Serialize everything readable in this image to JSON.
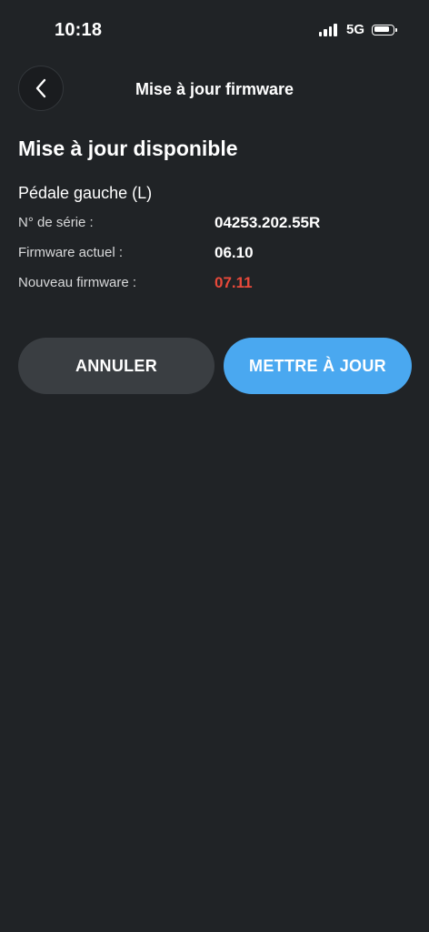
{
  "status_bar": {
    "time": "10:18",
    "network": "5G",
    "icons": [
      "cellular-signal-icon",
      "battery-icon"
    ]
  },
  "header": {
    "back_icon": "chevron-left-icon",
    "title": "Mise à jour firmware"
  },
  "main": {
    "heading": "Mise à jour disponible",
    "device_name": "Pédale gauche (L)",
    "rows": [
      {
        "label": "N° de série :",
        "value": "04253.202.55R"
      },
      {
        "label": "Firmware actuel :",
        "value": "06.10"
      },
      {
        "label": "Nouveau firmware :",
        "value": "07.11"
      }
    ]
  },
  "actions": {
    "cancel_label": "ANNULER",
    "update_label": "METTRE À JOUR"
  },
  "colors": {
    "background": "#202326",
    "new_version": "#e8493a",
    "primary_button": "#4aa8f0",
    "secondary_button": "#3a3e42"
  }
}
